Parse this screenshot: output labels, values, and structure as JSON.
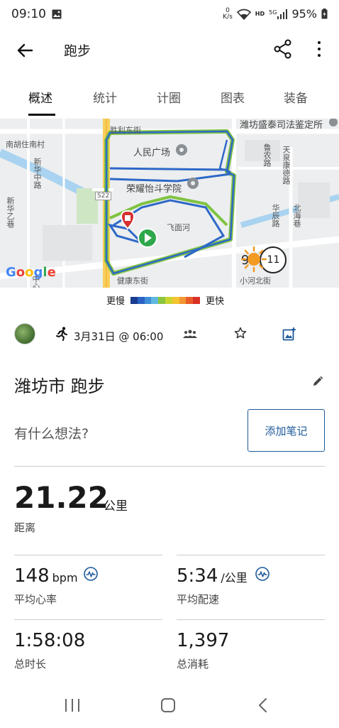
{
  "status": {
    "time": "09:10",
    "net_speed_value": "0",
    "net_speed_unit": "K/s",
    "hd": "HD",
    "network": "5G",
    "battery": "95%"
  },
  "app_bar": {
    "title": "跑步"
  },
  "tabs": [
    {
      "label": "概述"
    },
    {
      "label": "统计"
    },
    {
      "label": "计圈"
    },
    {
      "label": "图表"
    },
    {
      "label": "装备"
    }
  ],
  "map": {
    "labels": {
      "shengli": "胜利东街",
      "nanhu": "南胡住南村",
      "renmin": "人民广场",
      "ronghua": "荣耀怡斗学院",
      "feimian": "飞面河",
      "jiankang": "健康东街",
      "xiaohe": "小河北街",
      "top_right": "潍坊盛泰司法鉴定所",
      "s22": "S22",
      "xinhua": "新华中路",
      "xinhua2": "新华乙巷",
      "lu1": "鲁农路",
      "lu2": "天泉康德路",
      "lu3": "华辰路",
      "lu4": "北海巷",
      "zhong": "中心"
    },
    "google": "Google",
    "google_colors": [
      "#4285F4",
      "#EA4335",
      "#FBBC05",
      "#4285F4",
      "#34A853",
      "#EA4335"
    ],
    "temperature": "9°",
    "wind_speed": "11"
  },
  "legend": {
    "slower": "更慢",
    "faster": "更快",
    "colors": [
      "#1a3c8f",
      "#2b63c4",
      "#3f8fd8",
      "#5fb8e0",
      "#8cc63f",
      "#c8d630",
      "#f4c430",
      "#f29632",
      "#e85c2a",
      "#d93025"
    ]
  },
  "meta": {
    "date": "3月31日 @ 06:00"
  },
  "activity": {
    "title": "潍坊市 跑步",
    "notes_placeholder": "有什么想法?",
    "add_note": "添加笔记"
  },
  "stats": {
    "distance": {
      "value": "21.22",
      "unit": "公里",
      "label": "距离"
    },
    "heart_rate": {
      "value": "148",
      "unit": "bpm",
      "label": "平均心率"
    },
    "pace": {
      "value": "5:34",
      "unit": "/公里",
      "label": "平均配速"
    },
    "duration": {
      "value": "1:58:08",
      "label": "总时长"
    },
    "calories": {
      "value": "1,397",
      "label": "总消耗"
    }
  }
}
